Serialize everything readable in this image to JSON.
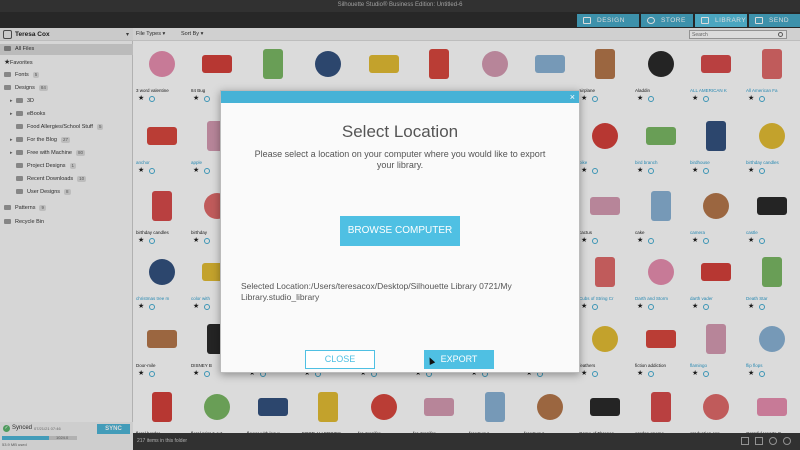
{
  "app": {
    "title": "Silhouette Studio® Business Edition: Untitled-6"
  },
  "nav": {
    "tabs": [
      {
        "label": "DESIGN"
      },
      {
        "label": "STORE"
      },
      {
        "label": "LIBRARY"
      },
      {
        "label": "SEND"
      }
    ],
    "active_tab": "LIBRARY"
  },
  "sidebar": {
    "user": "Teresa Cox",
    "items": [
      {
        "label": "All Files",
        "count": "",
        "selected": true
      },
      {
        "label": "Favorites",
        "count": ""
      },
      {
        "label": "Fonts",
        "count": "5"
      },
      {
        "label": "Designs",
        "count": "84"
      },
      {
        "label": "3D",
        "count": ""
      },
      {
        "label": "eBooks",
        "count": ""
      },
      {
        "label": "Food Allergies/School Stuff",
        "count": "5"
      },
      {
        "label": "For the Blog",
        "count": "27"
      },
      {
        "label": "Free with Machine",
        "count": "80"
      },
      {
        "label": "Project Designs",
        "count": "1"
      },
      {
        "label": "Recent Downloads",
        "count": "10"
      },
      {
        "label": "User Designs",
        "count": "8"
      },
      {
        "label": "Patterns",
        "count": "9"
      },
      {
        "label": "Recycle Bin",
        "count": ""
      }
    ]
  },
  "sync": {
    "status": "Synced",
    "time": "07/21/21 07:46",
    "button": "SYNC",
    "progress": 0.62,
    "size": "1024.0",
    "used": "53.9 MB used"
  },
  "toolbar": {
    "file_types": "File Types",
    "sort_by": "Sort By",
    "search_placeholder": "Search"
  },
  "grid": {
    "items": [
      [
        "3 word valentine",
        "84 Bug",
        "",
        "",
        "",
        "",
        "",
        "",
        "airplane",
        "Aladdin",
        "ALL AMERICAN K",
        "All American Fa"
      ],
      [
        "anchor",
        "apple",
        "",
        "",
        "",
        "",
        "",
        "",
        "bike",
        "bird branch",
        "birdhouse",
        "birthday candles"
      ],
      [
        "birthday candles",
        "birthday",
        "",
        "",
        "",
        "",
        "",
        "",
        "cactus",
        "cake",
        "camera",
        "castle"
      ],
      [
        "christmas tree m",
        "color with",
        "",
        "",
        "",
        "",
        "",
        "",
        "Cubs of String Cr",
        "Darth and Storm",
        "darth vader",
        "Death Star"
      ],
      [
        "Door-mile",
        "DISNEY B",
        "",
        "",
        "",
        "",
        "",
        "",
        "feathers",
        "fiction addiction",
        "flamingo",
        "flip flops"
      ],
      [
        "floral border",
        "floral print & cut",
        "flower with leave",
        "FOOD ALLERGIES",
        "for Jennifer",
        "for Jennifer",
        "for Vavavr",
        "for Vavavr",
        "Game of Thrones",
        "garden gnome",
        "graduation cap",
        "Grateful Hearts G"
      ]
    ]
  },
  "status": {
    "count_text": "217 items in this folder"
  },
  "modal": {
    "title": "Select Location",
    "description": "Please select a location on your computer where you would like to export your library.",
    "browse_button": "BROWSE COMPUTER",
    "selected_label": "Selected Location:",
    "selected_path": "/Users/teresacox/Desktop/Silhouette Library 0721/My Library.studio_library",
    "close_button": "CLOSE",
    "export_button": "EXPORT"
  }
}
